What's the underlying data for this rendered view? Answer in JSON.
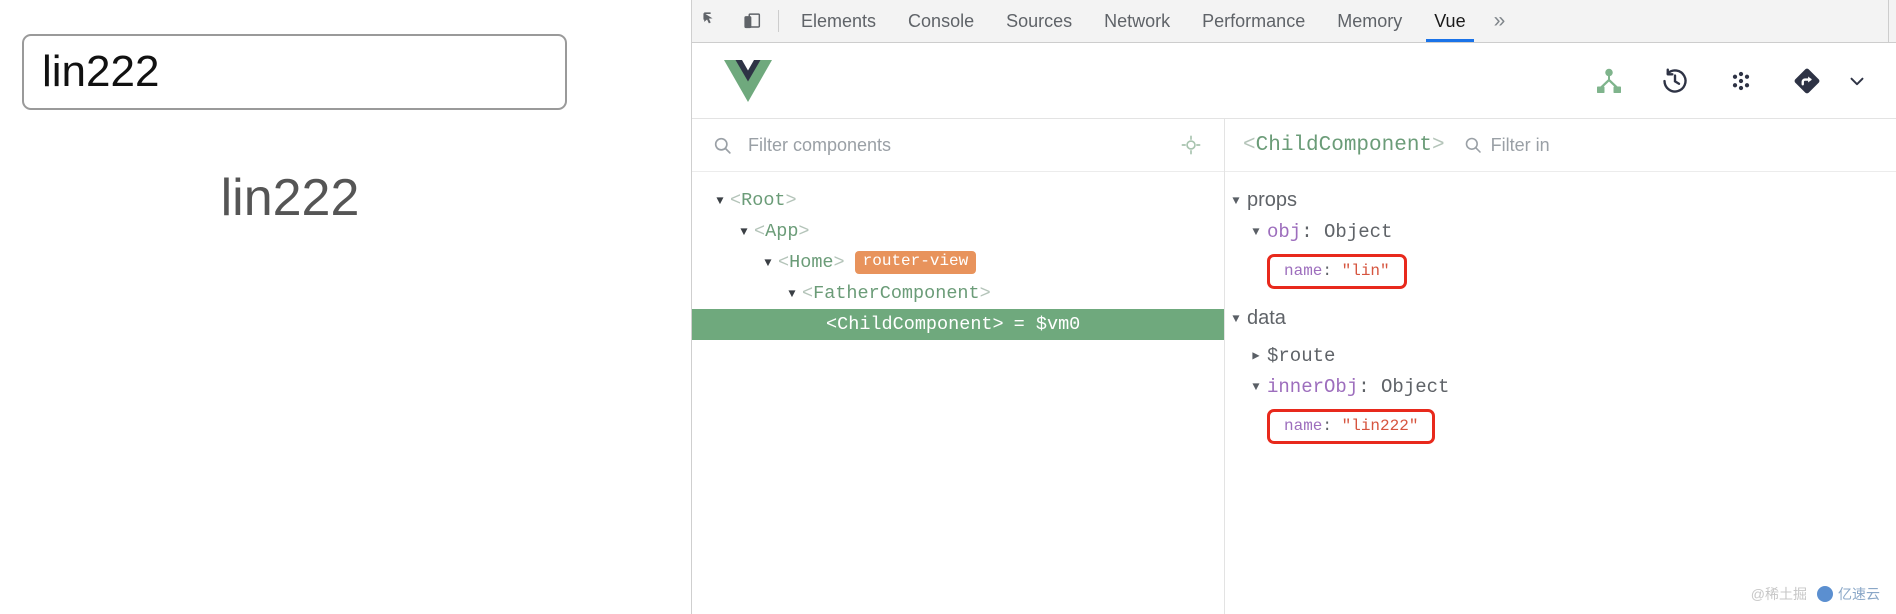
{
  "page": {
    "input_value": "lin222",
    "input_placeholder": "",
    "output_text": "lin222"
  },
  "devtools": {
    "icons": {
      "inspect": "inspect-element-icon",
      "device": "device-toolbar-icon"
    },
    "tabs": [
      {
        "label": "Elements",
        "active": false
      },
      {
        "label": "Console",
        "active": false
      },
      {
        "label": "Sources",
        "active": false
      },
      {
        "label": "Network",
        "active": false
      },
      {
        "label": "Performance",
        "active": false
      },
      {
        "label": "Memory",
        "active": false
      },
      {
        "label": "Vue",
        "active": true
      }
    ],
    "more_tabs_label": "»",
    "active_tab_accent": "#1a73e8"
  },
  "vue_panel": {
    "logo": "vue-logo-icon",
    "toolbar": [
      {
        "name": "component-tree-icon",
        "active": true
      },
      {
        "name": "timeline-history-icon",
        "active": false
      },
      {
        "name": "vuex-icon",
        "active": false
      },
      {
        "name": "router-icon",
        "active": false
      }
    ],
    "toolbar_chevron": "chevron-down-icon",
    "accent_green": "#6fa97d",
    "tree": {
      "search_placeholder": "Filter components",
      "search_icon": "search-icon",
      "select_target_icon": "target-crosshair-icon",
      "nodes": [
        {
          "depth": 0,
          "label": "<Root>",
          "arrow": "expanded",
          "badge": "",
          "selected": false
        },
        {
          "depth": 1,
          "label": "<App>",
          "arrow": "expanded",
          "badge": "",
          "selected": false
        },
        {
          "depth": 2,
          "label": "<Home>",
          "arrow": "expanded",
          "badge": "router-view",
          "selected": false
        },
        {
          "depth": 3,
          "label": "<FatherComponent>",
          "arrow": "expanded",
          "badge": "",
          "selected": false
        },
        {
          "depth": 4,
          "label": "<ChildComponent>",
          "arrow": "none",
          "badge": "",
          "selected": true,
          "suffix": "= $vm0"
        }
      ]
    },
    "inspector": {
      "title": "<ChildComponent>",
      "filter_icon": "search-icon",
      "filter_placeholder": "Filter in",
      "groups": [
        {
          "name": "props",
          "caret": "expanded",
          "rows": [
            {
              "kind": "object",
              "key": "obj",
              "type": "Object",
              "caret": "expanded"
            },
            {
              "kind": "highlighted",
              "key": "name",
              "value": "\"lin\"",
              "highlight_color": "#e8291c"
            }
          ]
        },
        {
          "name": "data",
          "caret": "expanded",
          "rows": [
            {
              "kind": "var",
              "key": "$route",
              "caret": "collapsed"
            },
            {
              "kind": "object",
              "key": "innerObj",
              "type": "Object",
              "caret": "expanded"
            },
            {
              "kind": "highlighted",
              "key": "name",
              "value": "\"lin222\"",
              "highlight_color": "#e8291c"
            }
          ]
        }
      ]
    }
  },
  "watermark": {
    "left_text": "@稀土掘",
    "right_text": "亿速云"
  }
}
